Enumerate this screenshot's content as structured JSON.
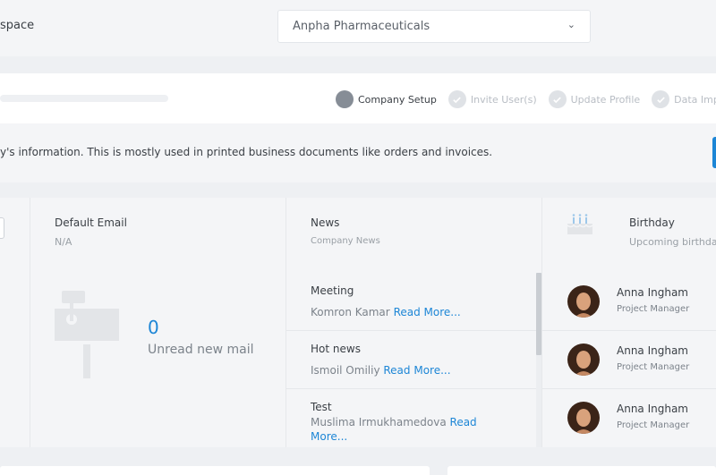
{
  "header": {
    "workspace_label": "space",
    "company_select": {
      "value": "Anpha Pharmaceuticals",
      "icon": "chevron-down-icon"
    }
  },
  "setup_progress": {
    "steps": [
      {
        "label": "Company Setup",
        "state": "active"
      },
      {
        "label": "Invite User(s)",
        "state": "pending"
      },
      {
        "label": "Update Profile",
        "state": "pending"
      },
      {
        "label": "Data Impo",
        "state": "pending"
      }
    ]
  },
  "info_text": "y's information. This is mostly used in printed business documents like orders and invoices.",
  "email_widget": {
    "title": "Default Email",
    "value": "N/A",
    "unread_count": "0",
    "unread_label": "Unread new mail",
    "icon": "mailbox-icon"
  },
  "news_widget": {
    "title": "News",
    "subtitle": "Company News",
    "read_more": "Read More...",
    "items": [
      {
        "title": "Meeting",
        "author": "Komron Kamar"
      },
      {
        "title": "Hot news",
        "author": "Ismoil Omiliy"
      },
      {
        "title": "Test",
        "author": "Muslima Irmukhamedova"
      }
    ]
  },
  "birthday_widget": {
    "title": "Birthday",
    "subtitle": "Upcoming birthda",
    "icon": "birthday-cake-icon",
    "people": [
      {
        "name": "Anna Ingham",
        "role": "Project Manager"
      },
      {
        "name": "Anna Ingham",
        "role": "Project Manager"
      },
      {
        "name": "Anna Ingham",
        "role": "Project Manager"
      }
    ]
  },
  "colors": {
    "accent": "#1d86d6",
    "background": "#eef0f3",
    "panel": "#f4f5f7",
    "step_active": "#868d96",
    "step_pending": "#dfe2e6"
  }
}
